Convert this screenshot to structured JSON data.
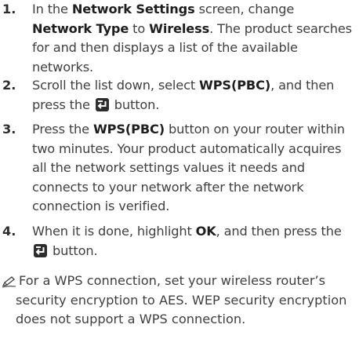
{
  "steps": [
    {
      "number": "1.",
      "parts": [
        {
          "t": "In the ",
          "b": false
        },
        {
          "t": "Network Settings",
          "b": true
        },
        {
          "t": " screen, change ",
          "b": false
        },
        {
          "t": "Network Type",
          "b": true
        },
        {
          "t": " to ",
          "b": false
        },
        {
          "t": "Wireless",
          "b": true
        },
        {
          "t": ". The product searches for and then displays a list of the available networks.",
          "b": false
        }
      ]
    },
    {
      "number": "2.",
      "parts": [
        {
          "t": "Scroll the list down, select ",
          "b": false
        },
        {
          "t": "WPS(PBC)",
          "b": true
        },
        {
          "t": ", and then press the ",
          "b": false
        },
        {
          "icon": "enter-button-icon"
        },
        {
          "t": " button.",
          "b": false
        }
      ]
    },
    {
      "number": "3.",
      "parts": [
        {
          "t": "Press the ",
          "b": false
        },
        {
          "t": "WPS(PBC)",
          "b": true
        },
        {
          "t": " button on your router within two minutes. Your product automatically acquires all the network settings values it needs and connects to your network after the network connection is verified.",
          "b": false
        }
      ]
    },
    {
      "number": "4.",
      "parts": [
        {
          "t": "When it is done, highlight ",
          "b": false
        },
        {
          "t": "OK",
          "b": true
        },
        {
          "t": ", and then press the ",
          "b": false
        },
        {
          "icon": "enter-button-icon"
        },
        {
          "t": " button.",
          "b": false
        }
      ]
    }
  ],
  "note": {
    "icon": "note-pencil-icon",
    "text": "For a WPS connection, set your wireless router’s security encryption to AES. WEP security encryption does not support a WPS connection."
  },
  "colors": {
    "text": "#3f3f3f",
    "bold_text": "#1e1e1e",
    "button_fill": "#2d2d2d"
  }
}
